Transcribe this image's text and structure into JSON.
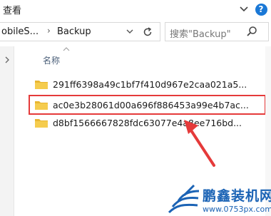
{
  "ribbon": {
    "tab_label": "查看",
    "expand_icon": "chevron-down-icon",
    "help_label": "?"
  },
  "address": {
    "path_part_1": "obileS...",
    "path_part_2": "Backup",
    "separator": "›",
    "refresh_icon": "refresh-icon"
  },
  "search": {
    "placeholder": "搜索\"Backup\"",
    "icon": "search-icon"
  },
  "file_list": {
    "column_name": "名称",
    "items": [
      {
        "name": "291ff6398a49c1bf7f410d967e2caa021a5..."
      },
      {
        "name": "ac0e3b28061d00a696f886453a99e4b7ac..."
      },
      {
        "name": "d8bf1566667828fdc63077e4a8ee716bd..."
      }
    ],
    "highlighted_index": 1
  },
  "annotation": {
    "highlight_color": "#e53a3a",
    "arrow_color": "#e53a3a"
  },
  "watermark": {
    "title": "鹏鑫装机网",
    "url": "www.0753px.com"
  },
  "colors": {
    "folder": "#e8b632",
    "accent": "#1a78d6",
    "watermark": "#1b63b5"
  }
}
